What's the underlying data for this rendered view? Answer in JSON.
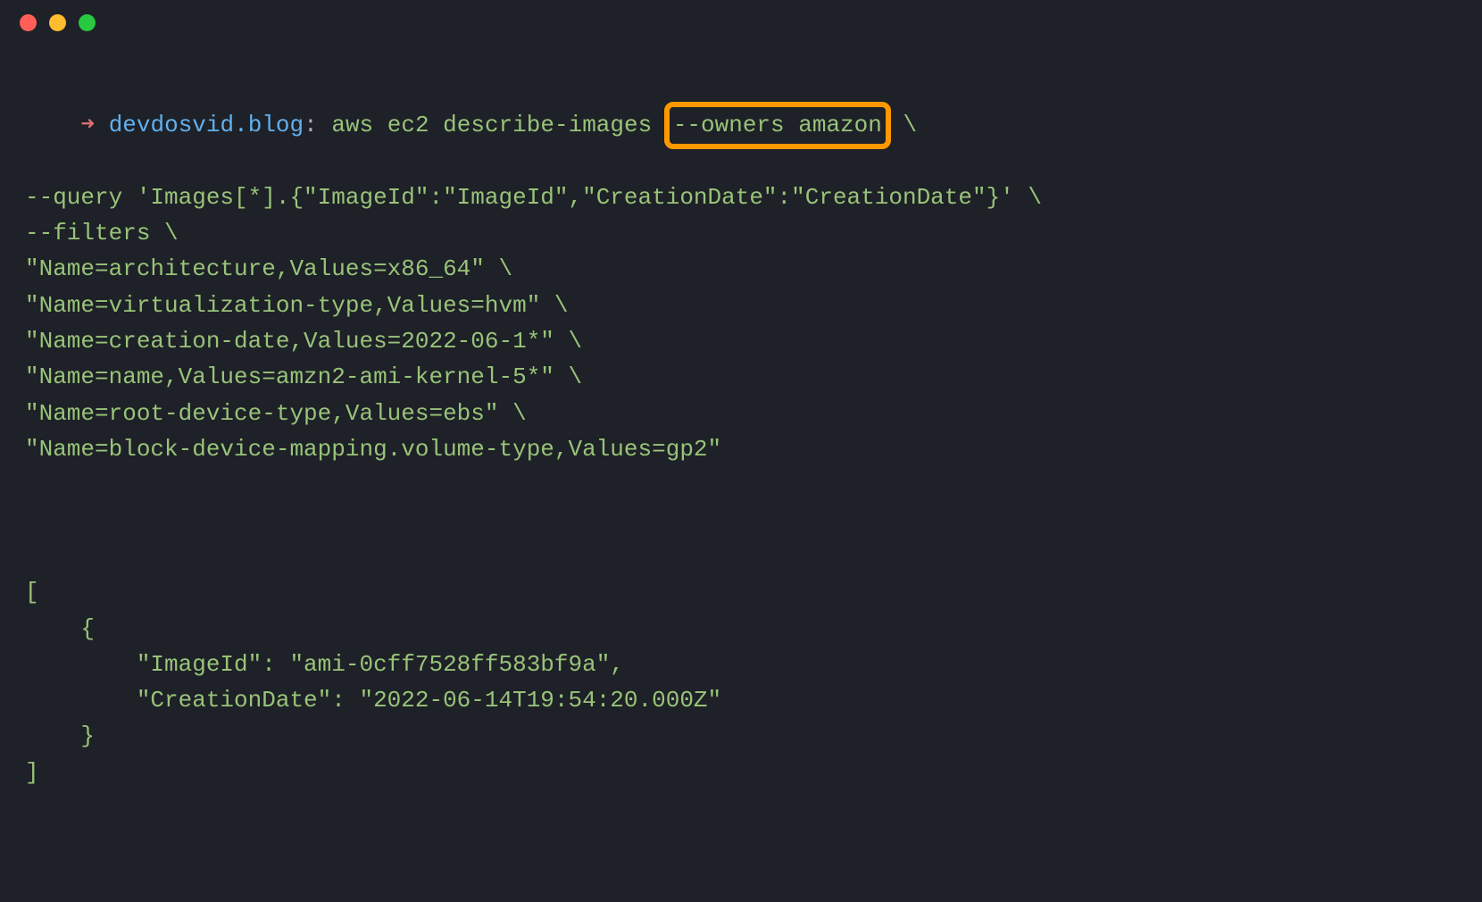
{
  "titlebar": {
    "close": "close",
    "minimize": "minimize",
    "maximize": "maximize"
  },
  "prompt": {
    "arrow": "➜",
    "host": "devdosvid.blog",
    "colon": ":"
  },
  "command": {
    "line1_pre": "aws ec2 describe-images ",
    "highlight": "--owners amazon",
    "line1_post": " \\",
    "line2": "--query 'Images[*].{\"ImageId\":\"ImageId\",\"CreationDate\":\"CreationDate\"}' \\",
    "line3": "--filters \\",
    "line4": "\"Name=architecture,Values=x86_64\" \\",
    "line5": "\"Name=virtualization-type,Values=hvm\" \\",
    "line6": "\"Name=creation-date,Values=2022-06-1*\" \\",
    "line7": "\"Name=name,Values=amzn2-ami-kernel-5*\" \\",
    "line8": "\"Name=root-device-type,Values=ebs\" \\",
    "line9": "\"Name=block-device-mapping.volume-type,Values=gp2\""
  },
  "output": {
    "l1": "[",
    "l2": "    {",
    "l3": "        \"ImageId\": \"ami-0cff7528ff583bf9a\",",
    "l4": "        \"CreationDate\": \"2022-06-14T19:54:20.000Z\"",
    "l5": "    }",
    "l6": "]"
  }
}
